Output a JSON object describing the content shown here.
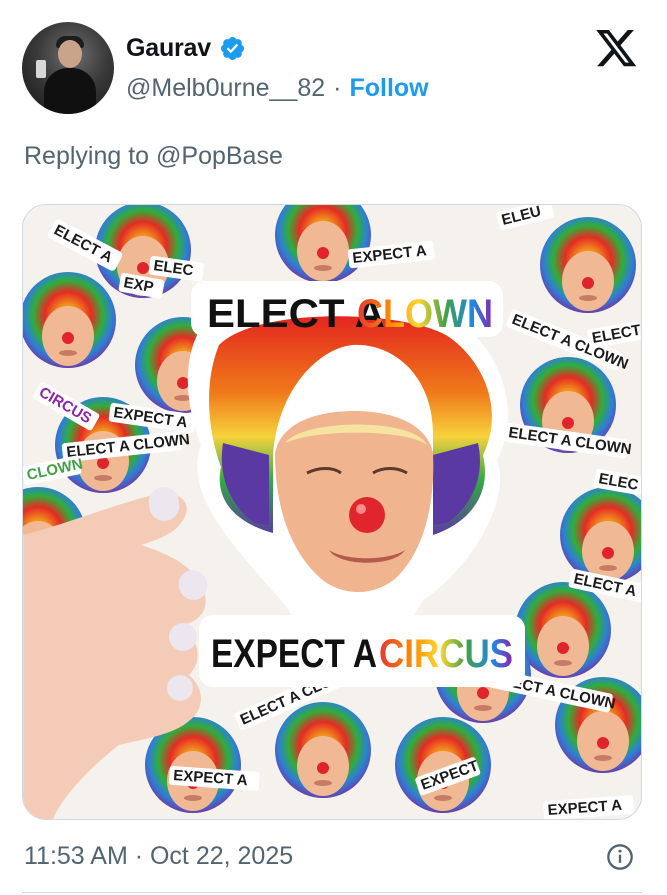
{
  "author": {
    "name": "Gaurav",
    "handle": "@Melb0urne__82",
    "separator": "·",
    "follow_label": "Follow",
    "verified": true
  },
  "reply": {
    "text": "Replying to @PopBase"
  },
  "media": {
    "sticker_top": {
      "part1": "ELECT A ",
      "part2": "CLOWN"
    },
    "sticker_bottom": {
      "part1": "EXPECT A ",
      "part2": "CIRCUS"
    },
    "bg_labels": {
      "elect": "ELECT A",
      "expect": "EXPECT A",
      "elect_clown": "ELECT A CLOWN",
      "circus": "CIRCUS",
      "clown": "CLOWN",
      "elec": "ELEC",
      "elect_short": "ELECT",
      "expect_short": "EXPECT",
      "expt": "EXP",
      "elec_upper": "ELEU"
    }
  },
  "footer": {
    "timestamp": "11:53 AM · Oct 22, 2025"
  },
  "colors": {
    "accent": "#1d9bf0",
    "muted": "#536471",
    "border": "#cfd9de"
  },
  "icons": {
    "logo": "x-logo-icon",
    "verified": "verified-badge-icon",
    "info": "info-icon"
  }
}
